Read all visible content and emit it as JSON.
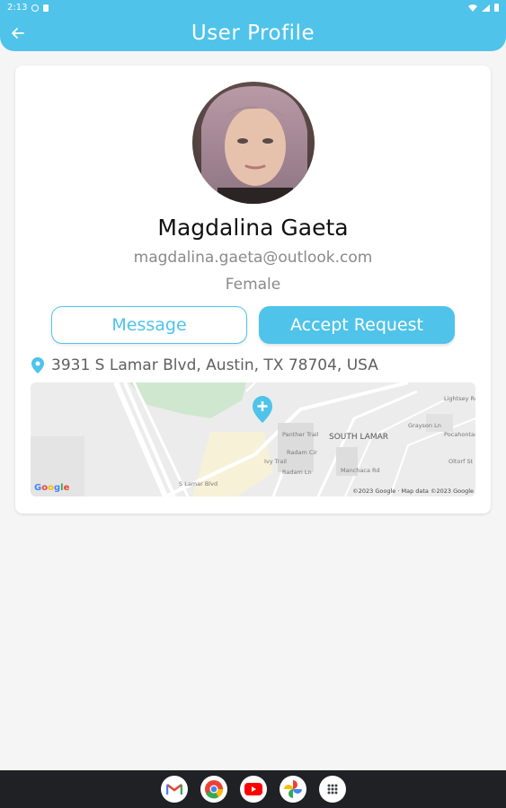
{
  "status_bar": {
    "time": "2:13"
  },
  "app_bar": {
    "title": "User Profile"
  },
  "profile": {
    "name": "Magdalina Gaeta",
    "email": "magdalina.gaeta@outlook.com",
    "gender": "Female",
    "address": "3931 S Lamar Blvd, Austin, TX 78704, USA"
  },
  "actions": {
    "message_label": "Message",
    "accept_label": "Accept Request"
  },
  "map": {
    "area_label": "SOUTH LAMAR",
    "street_labels": [
      "S Lamar Blvd",
      "Panther Trail",
      "Radam Cir",
      "Manchaca Rd",
      "Radam Ln",
      "Lightsey Rd",
      "Oltorf St",
      "Grayson Ln",
      "Pocahontas Trail",
      "Ivy Trail"
    ],
    "copyright": "©2023 Google · Map data ©2023 Google",
    "logo": "Google"
  },
  "taskbar": {
    "apps": [
      "gmail-icon",
      "chrome-icon",
      "youtube-icon",
      "photos-icon",
      "app-drawer-icon"
    ]
  },
  "colors": {
    "accent": "#4fc3ea",
    "text_primary": "#111111",
    "text_secondary": "#8a8a8a",
    "background": "#f5f5f5"
  }
}
